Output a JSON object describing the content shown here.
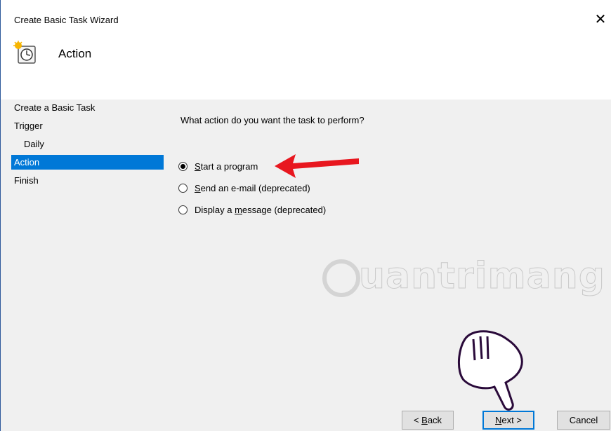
{
  "window": {
    "title": "Create Basic Task Wizard",
    "close_glyph": "✕"
  },
  "header": {
    "title": "Action",
    "icon": "task-scheduler-clock-icon"
  },
  "sidebar": {
    "items": [
      {
        "label": "Create a Basic Task",
        "active": false
      },
      {
        "label": "Trigger",
        "active": false
      },
      {
        "label": "Daily",
        "active": false
      },
      {
        "label": "Action",
        "active": true
      },
      {
        "label": "Finish",
        "active": false
      }
    ]
  },
  "main": {
    "prompt": "What action do you want the task to perform?",
    "options": [
      {
        "label_pre": "",
        "accel": "S",
        "label_post": "tart a program",
        "checked": true
      },
      {
        "label_pre": "",
        "accel": "S",
        "label_post": "end an e-mail (deprecated)",
        "checked": false
      },
      {
        "label_pre": "Display a ",
        "accel": "m",
        "label_post": "essage (deprecated)",
        "checked": false
      }
    ]
  },
  "watermark": {
    "text": "uantrimang"
  },
  "buttons": {
    "back": {
      "pre": "< ",
      "accel": "B",
      "post": "ack"
    },
    "next": {
      "pre": "",
      "accel": "N",
      "post": "ext >"
    },
    "cancel": {
      "label": "Cancel"
    }
  },
  "colors": {
    "selection": "#0078d7",
    "content_bg": "#f0f0f0",
    "arrow": "#e8171f"
  }
}
